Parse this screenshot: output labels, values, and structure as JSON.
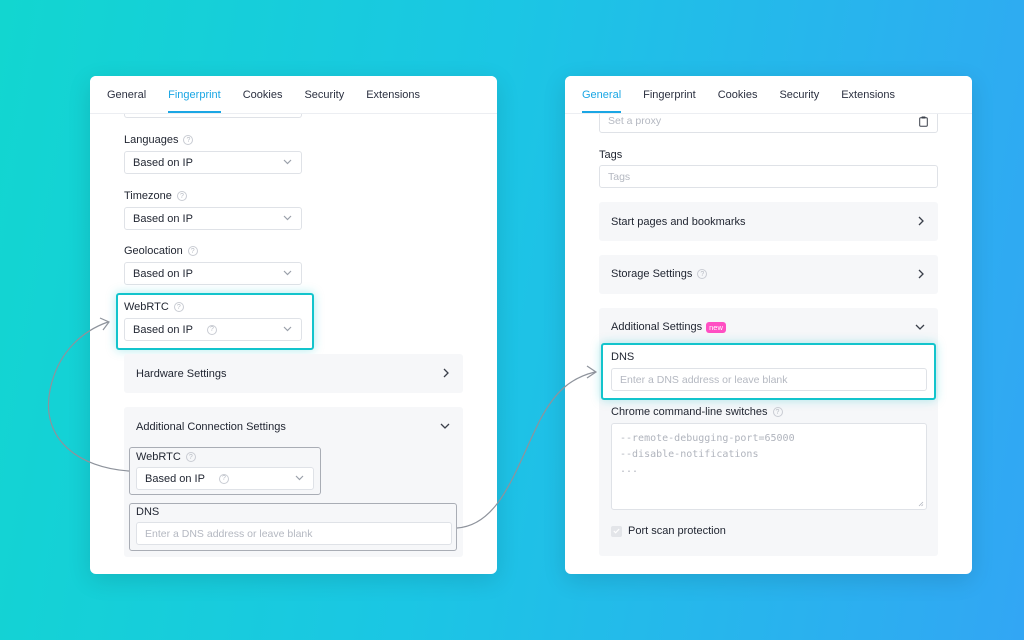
{
  "left_panel": {
    "tabs": [
      {
        "label": "General",
        "active": false
      },
      {
        "label": "Fingerprint",
        "active": true
      },
      {
        "label": "Cookies",
        "active": false
      },
      {
        "label": "Security",
        "active": false
      },
      {
        "label": "Extensions",
        "active": false
      }
    ],
    "languages": {
      "label": "Languages",
      "value": "Based on IP"
    },
    "timezone": {
      "label": "Timezone",
      "value": "Based on IP"
    },
    "geolocation": {
      "label": "Geolocation",
      "value": "Based on IP"
    },
    "webrtc": {
      "label": "WebRTC",
      "value": "Based on IP"
    },
    "hardware_settings": {
      "title": "Hardware Settings"
    },
    "additional_connection": {
      "title": "Additional Connection Settings",
      "webrtc": {
        "label": "WebRTC",
        "value": "Based on IP"
      },
      "dns": {
        "label": "DNS",
        "placeholder": "Enter a DNS address or leave blank"
      }
    }
  },
  "right_panel": {
    "tabs": [
      {
        "label": "General",
        "active": true
      },
      {
        "label": "Fingerprint",
        "active": false
      },
      {
        "label": "Cookies",
        "active": false
      },
      {
        "label": "Security",
        "active": false
      },
      {
        "label": "Extensions",
        "active": false
      }
    ],
    "proxy": {
      "placeholder": "Set a proxy"
    },
    "tags": {
      "label": "Tags",
      "placeholder": "Tags"
    },
    "start_pages": {
      "title": "Start pages and bookmarks"
    },
    "storage_settings": {
      "title": "Storage Settings"
    },
    "additional_settings": {
      "title": "Additional Settings",
      "badge": "new",
      "dns": {
        "label": "DNS",
        "placeholder": "Enter a DNS address or leave blank"
      },
      "chrome_switches": {
        "label": "Chrome command-line switches",
        "lines": [
          "--remote-debugging-port=65000",
          "--disable-notifications",
          "..."
        ]
      },
      "port_scan": {
        "label": "Port scan protection",
        "checked": true
      }
    }
  },
  "colors": {
    "accent": "#1aa6e4",
    "highlight": "#13c4cc",
    "badge": "#ff4fc3",
    "background_start": "#12d6d0",
    "background_end": "#32a6f4"
  }
}
